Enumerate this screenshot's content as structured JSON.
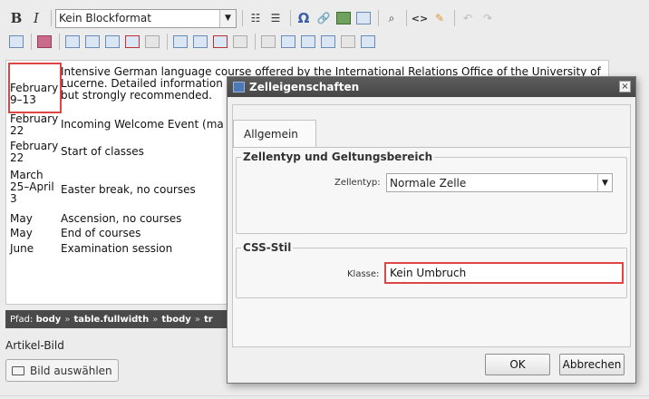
{
  "toolbar": {
    "format_select": "Kein Blockformat",
    "icons_row1": [
      "bold-icon",
      "italic-icon",
      "ordered-list-icon",
      "unordered-list-icon",
      "special-char-icon",
      "link-icon",
      "image-icon",
      "table-icon",
      "find-icon",
      "source-code-icon",
      "clean-icon",
      "undo-icon",
      "redo-icon"
    ],
    "bold_glyph": "B",
    "italic_glyph": "I",
    "omega_glyph": "Ω",
    "source_glyph": "<>"
  },
  "content": {
    "rows": [
      {
        "date": "February 9–13",
        "text": "Intensive German language course offered by the International Relations Office of the University of Lucerne. Detailed information",
        "text2": "but strongly recommended."
      },
      {
        "date": "February 22",
        "text": "Incoming Welcome Event (ma"
      },
      {
        "date": "February 22",
        "text": "Start of classes"
      },
      {
        "date": "March 25–April 3",
        "text": "Easter break, no courses"
      },
      {
        "date": "May",
        "text": "Ascension, no courses"
      },
      {
        "date": "May",
        "text": "End of courses"
      },
      {
        "date": "June",
        "text": "Examination session"
      }
    ]
  },
  "pathbar": {
    "label": "Pfad:",
    "items": [
      "body",
      "table.fullwidth",
      "tbody",
      "tr"
    ],
    "separator": "»"
  },
  "article": {
    "label": "Artikel-Bild",
    "button": "Bild auswählen"
  },
  "dialog": {
    "title": "Zelleigenschaften",
    "tab": "Allgemein",
    "group1_legend": "Zellentyp und Geltungsbereich",
    "celltype_label": "Zellentyp:",
    "celltype_value": "Normale Zelle",
    "group2_legend": "CSS-Stil",
    "class_label": "Klasse:",
    "class_value": "Kein Umbruch",
    "ok": "OK",
    "cancel": "Abbrechen",
    "close_glyph": "×"
  },
  "colors": {
    "highlight": "#e04545",
    "dialog_title_bg": "#474747"
  }
}
